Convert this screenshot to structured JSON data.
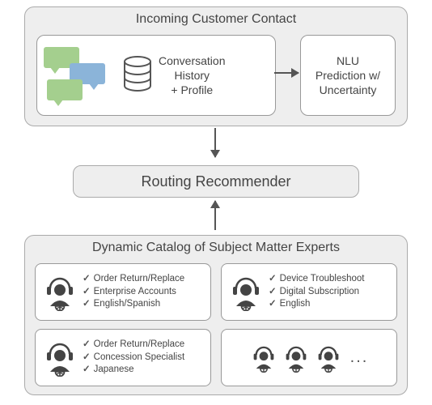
{
  "top": {
    "title": "Incoming Customer Contact",
    "conversation_label": "Conversation\nHistory\n+ Profile",
    "nlu_label": "NLU\nPrediction w/\nUncertainty"
  },
  "routing": {
    "label": "Routing Recommender"
  },
  "bottom": {
    "title": "Dynamic Catalog of Subject Matter Experts",
    "experts": [
      {
        "skills": [
          "Order Return/Replace",
          "Enterprise Accounts",
          "English/Spanish"
        ]
      },
      {
        "skills": [
          "Device Troubleshoot",
          "Digital Subscription",
          "English"
        ]
      },
      {
        "skills": [
          "Order Return/Replace",
          "Concession Specialist",
          "Japanese"
        ]
      }
    ],
    "ellipsis": "..."
  }
}
